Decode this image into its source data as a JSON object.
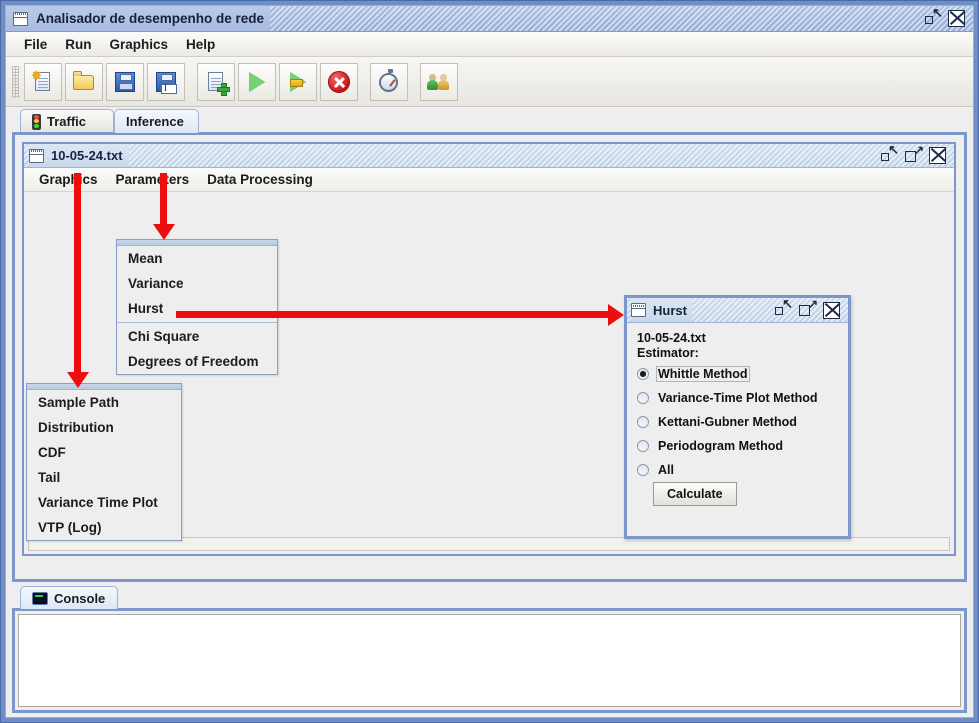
{
  "window": {
    "title": "Analisador de desempenho de rede",
    "icon": "window-icon",
    "buttons": {
      "minimize": "minimize-icon",
      "close": "close-icon"
    }
  },
  "menubar": {
    "items": [
      {
        "label": "File"
      },
      {
        "label": "Run"
      },
      {
        "label": "Graphics"
      },
      {
        "label": "Help"
      }
    ]
  },
  "toolbar": {
    "buttons": [
      {
        "name": "new-file-button",
        "icon": "new-file-icon",
        "tooltip": "New"
      },
      {
        "name": "open-file-button",
        "icon": "open-folder-icon",
        "tooltip": "Open"
      },
      {
        "name": "save-button",
        "icon": "save-floppy-icon",
        "tooltip": "Save"
      },
      {
        "name": "save-as-button",
        "icon": "save-as-floppy-icon",
        "tooltip": "Save As"
      },
      {
        "name": "new-document-button",
        "icon": "document-add-icon",
        "tooltip": "New Document"
      },
      {
        "name": "run-button",
        "icon": "play-icon",
        "tooltip": "Run"
      },
      {
        "name": "run-step-button",
        "icon": "play-flag-icon",
        "tooltip": "Run Step"
      },
      {
        "name": "stop-button",
        "icon": "stop-error-icon",
        "tooltip": "Stop"
      },
      {
        "name": "timer-button",
        "icon": "stopwatch-icon",
        "tooltip": "Timer"
      },
      {
        "name": "users-button",
        "icon": "users-icon",
        "tooltip": "Users"
      }
    ]
  },
  "tabs": {
    "items": [
      {
        "label": "Traffic",
        "icon": "traffic-light-icon",
        "selected": false
      },
      {
        "label": "Inference",
        "icon": "",
        "selected": true
      }
    ]
  },
  "internal_window": {
    "title": "10-05-24.txt",
    "icon": "window-icon",
    "menubar": [
      {
        "label": "Graphics"
      },
      {
        "label": "Parameters"
      },
      {
        "label": "Data Processing"
      }
    ]
  },
  "graphics_menu": {
    "items": [
      {
        "label": "Sample Path"
      },
      {
        "label": "Distribution"
      },
      {
        "label": "CDF"
      },
      {
        "label": "Tail"
      },
      {
        "label": "Variance Time Plot"
      },
      {
        "label": "VTP (Log)"
      }
    ]
  },
  "parameters_menu": {
    "group_a": [
      {
        "label": "Mean"
      },
      {
        "label": "Variance"
      },
      {
        "label": "Hurst"
      }
    ],
    "group_b": [
      {
        "label": "Chi Square"
      },
      {
        "label": "Degrees of Freedom"
      }
    ]
  },
  "hurst_dialog": {
    "title": "Hurst",
    "icon": "window-icon",
    "file_name": "10-05-24.txt",
    "estimator_label": "Estimator:",
    "options": [
      {
        "label": "Whittle Method",
        "selected": true,
        "focused": true
      },
      {
        "label": "Variance-Time Plot Method",
        "selected": false,
        "focused": false
      },
      {
        "label": "Kettani-Gubner Method",
        "selected": false,
        "focused": false
      },
      {
        "label": "Periodogram Method",
        "selected": false,
        "focused": false
      },
      {
        "label": "All",
        "selected": false,
        "focused": false
      }
    ],
    "calculate_label": "Calculate"
  },
  "console": {
    "tab_label": "Console",
    "icon": "console-monitor-icon",
    "content": ""
  },
  "annotations": {
    "arrow_color": "#ec0d0d",
    "arrows": [
      {
        "name": "arrow-graphics-menu",
        "direction": "down"
      },
      {
        "name": "arrow-parameters-menu",
        "direction": "down"
      },
      {
        "name": "arrow-hurst-to-whittle",
        "direction": "right"
      }
    ]
  },
  "colors": {
    "frame_blue": "#7b97cc",
    "titlebar_blue": "#9cb5dd",
    "panel_gray": "#eeeeee",
    "accent_red": "#ec0d0d"
  }
}
